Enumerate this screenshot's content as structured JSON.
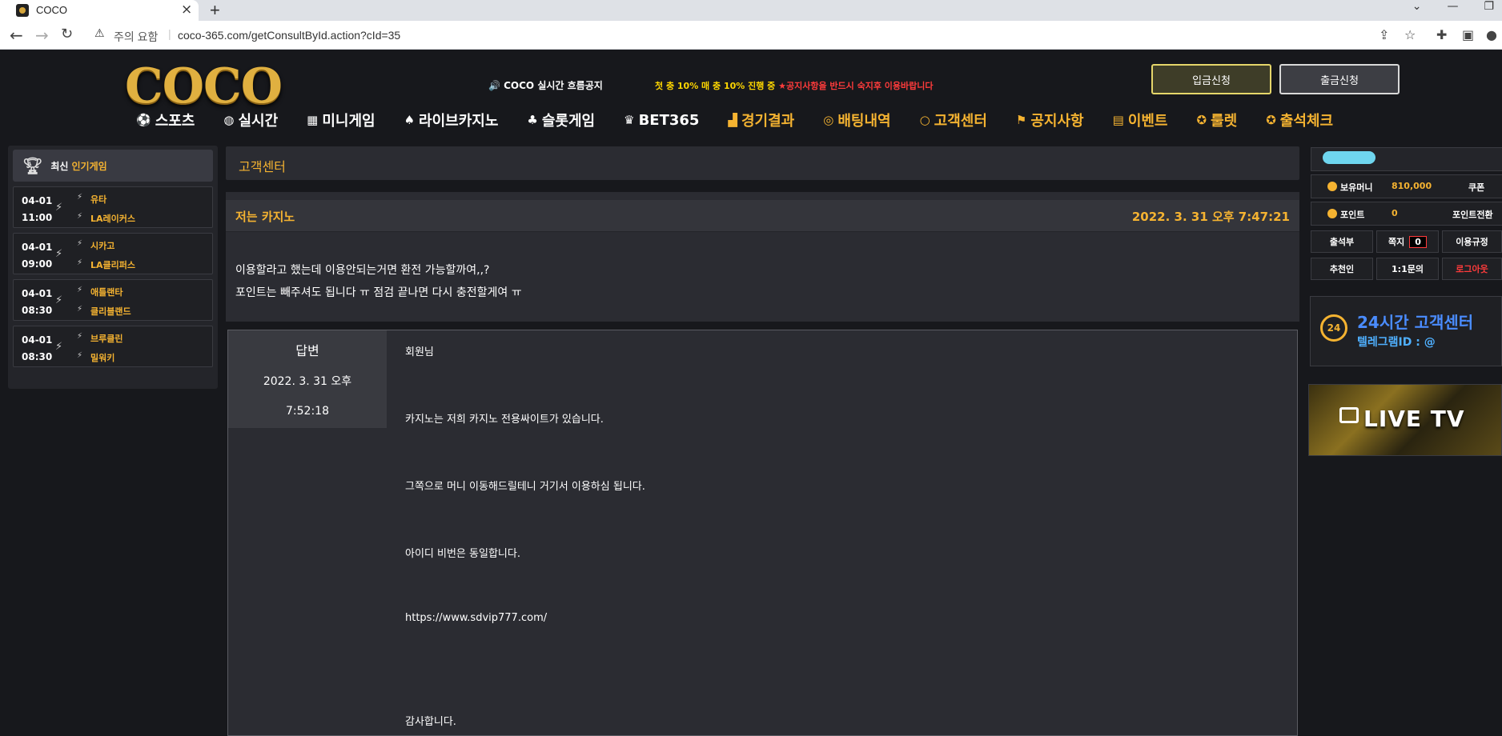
{
  "browser": {
    "tab_title": "COCO",
    "new_tab": "+",
    "not_secure": "주의 요함",
    "url": "coco-365.com/getConsultById.action?cId=35"
  },
  "header": {
    "logo": "COCO",
    "notice_label": "🔊 COCO 실시간 흐름공지",
    "notice_yellow": "첫 충 10% 매 충 10% 진행 중 ",
    "notice_red": "★공지사항을 반드시 숙지후 이용바랍니다",
    "deposit_button": "입금신청",
    "withdraw_button": "출금신청"
  },
  "nav": [
    {
      "label": "스포츠",
      "icon": "soccer-ball-icon"
    },
    {
      "label": "실시간",
      "icon": "basketball-icon"
    },
    {
      "label": "미니게임",
      "icon": "arcade-icon"
    },
    {
      "label": "라이브카지노",
      "icon": "casino-chip-icon"
    },
    {
      "label": "슬롯게임",
      "icon": "slot-icon"
    },
    {
      "label": "BET365",
      "icon": "trophy-icon"
    },
    {
      "label": "경기결과",
      "icon": "chart-icon"
    },
    {
      "label": "배팅내역",
      "icon": "target-icon"
    },
    {
      "label": "고객센터",
      "icon": "headset-icon"
    },
    {
      "label": "공지사항",
      "icon": "megaphone-icon"
    },
    {
      "label": "이벤트",
      "icon": "list-icon"
    },
    {
      "label": "룰렛",
      "icon": "roulette-icon"
    },
    {
      "label": "출석체크",
      "icon": "check-circle-icon"
    }
  ],
  "sidebar": {
    "title_a": "최신",
    "title_b": "인기게임",
    "matches": [
      {
        "date": "04-01",
        "time": "11:00",
        "team1": "유타",
        "team2": "LA레이커스"
      },
      {
        "date": "04-01",
        "time": "09:00",
        "team1": "시카고",
        "team2": "LA클리퍼스"
      },
      {
        "date": "04-01",
        "time": "08:30",
        "team1": "애틀랜타",
        "team2": "클리블랜드"
      },
      {
        "date": "04-01",
        "time": "08:30",
        "team1": "브루클린",
        "team2": "밀워키"
      }
    ]
  },
  "main": {
    "section_title": "고객센터",
    "post": {
      "title": "저는 카지노",
      "date": "2022. 3. 31 오후 7:47:21",
      "line1": "이용할라고 했는데 이용안되는거면 환전 가능할까여,,?",
      "line2": "포인트는 빼주셔도 됩니다 ㅠ 점검 끝나면 다시 충전할게여 ㅠ"
    },
    "answer": {
      "label": "답변",
      "date1": "2022. 3. 31 오후",
      "date2": "7:52:18",
      "lines": [
        "회원님",
        "카지노는 저희 카지노 전용싸이트가 있습니다.",
        "그쪽으로 머니 이동해드릴테니 거기서 이용하심 됩니다.",
        "아이디 비번은 동일합니다.",
        "https://www.sdvip777.com/",
        "감사합니다."
      ]
    }
  },
  "right": {
    "money_label": "보유머니",
    "money_value": "810,000",
    "coupon": "쿠폰",
    "point_label": "포인트",
    "point_value": "0",
    "point_convert": "포인트전환",
    "attendance": "출석부",
    "memo": "쪽지",
    "memo_count": "0",
    "rules": "이용규정",
    "referrer": "추천인",
    "inquiry": "1:1문의",
    "logout": "로그아웃",
    "cs_badge": "24",
    "cs_title": "24시간 고객센터",
    "cs_telegram": "텔레그램ID : @",
    "live_tv": "LIVE TV"
  }
}
